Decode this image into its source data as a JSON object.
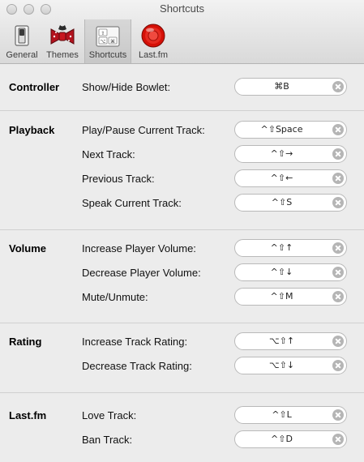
{
  "window": {
    "title": "Shortcuts"
  },
  "toolbar": {
    "items": [
      {
        "label": "General",
        "icon": "switch-icon"
      },
      {
        "label": "Themes",
        "icon": "bowtie-icon"
      },
      {
        "label": "Shortcuts",
        "icon": "keyboard-keys-icon",
        "selected": true
      },
      {
        "label": "Last.fm",
        "icon": "lastfm-record-icon"
      }
    ]
  },
  "sections": {
    "controller": {
      "title": "Controller",
      "rows": [
        {
          "label": "Show/Hide Bowlet:",
          "keys": "⌘B"
        }
      ]
    },
    "playback": {
      "title": "Playback",
      "rows": [
        {
          "label": "Play/Pause Current Track:",
          "keys": "^⇧Space"
        },
        {
          "label": "Next Track:",
          "keys": "^⇧→"
        },
        {
          "label": "Previous Track:",
          "keys": "^⇧←"
        },
        {
          "label": "Speak Current Track:",
          "keys": "^⇧S"
        }
      ]
    },
    "volume": {
      "title": "Volume",
      "rows": [
        {
          "label": "Increase Player Volume:",
          "keys": "^⇧↑"
        },
        {
          "label": "Decrease Player Volume:",
          "keys": "^⇧↓"
        },
        {
          "label": "Mute/Unmute:",
          "keys": "^⇧M"
        }
      ]
    },
    "rating": {
      "title": "Rating",
      "rows": [
        {
          "label": "Increase Track Rating:",
          "keys": "⌥⇧↑"
        },
        {
          "label": "Decrease Track Rating:",
          "keys": "⌥⇧↓"
        }
      ]
    },
    "lastfm": {
      "title": "Last.fm",
      "rows": [
        {
          "label": "Love Track:",
          "keys": "^⇧L"
        },
        {
          "label": "Ban Track:",
          "keys": "^⇧D"
        }
      ]
    }
  },
  "colors": {
    "window_bg": "#ececec",
    "lastfm_red": "#d51007",
    "clear_button": "#b5b5b5"
  }
}
